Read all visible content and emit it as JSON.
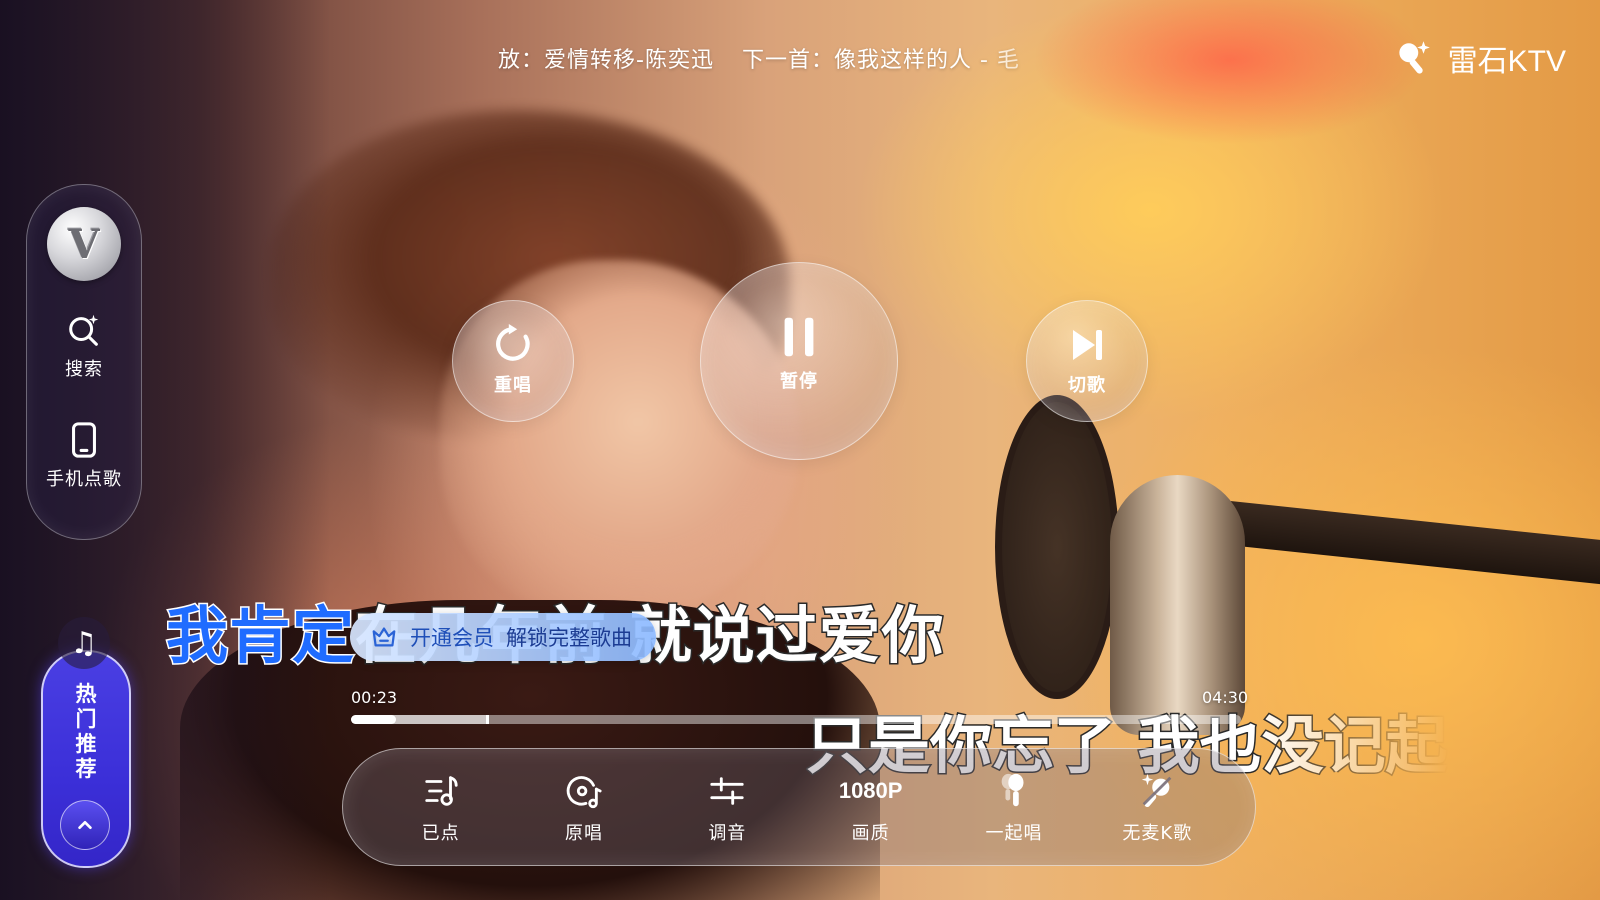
{
  "now_playing": {
    "current": "放：爱情转移-陈奕迅",
    "next": "下一首：像我这样的人 - 毛"
  },
  "brand": {
    "name": "雷石KTV"
  },
  "sidebar": {
    "vip_badge": "V",
    "items": [
      {
        "label": "搜索",
        "icon": "search-sparkle-icon"
      },
      {
        "label": "手机点歌",
        "icon": "phone-icon"
      }
    ],
    "hot": {
      "chars": [
        "热",
        "门",
        "推",
        "荐"
      ],
      "icon": "music-note-icon",
      "toggle_icon": "chevron-up-icon"
    }
  },
  "controls": {
    "restart": {
      "label": "重唱",
      "icon": "restart-icon"
    },
    "pause": {
      "label": "暂停",
      "icon": "pause-icon"
    },
    "skip": {
      "label": "切歌",
      "icon": "skip-next-icon"
    }
  },
  "lyrics": {
    "line1_sung": "我肯定",
    "line1_unsung": "在几年前 就说过爱你",
    "line2": "只是你忘了 我也没记起"
  },
  "vip_promo": {
    "prefix": "开通会员",
    "main": "解锁完整歌曲",
    "icon": "crown-icon"
  },
  "progress": {
    "current_time": "00:23",
    "total_time": "04:30",
    "played_fraction": 0.05,
    "buffered_fraction": 0.152
  },
  "toolbar": {
    "items": [
      {
        "label": "已点",
        "icon": "queue-list-icon"
      },
      {
        "label": "原唱",
        "icon": "original-vocal-icon"
      },
      {
        "label": "调音",
        "icon": "equalizer-icon"
      },
      {
        "label": "画质",
        "icon_text": "1080P"
      },
      {
        "label": "一起唱",
        "icon": "duet-mic-icon"
      },
      {
        "label": "无麦K歌",
        "icon": "no-mic-icon"
      }
    ]
  },
  "colors": {
    "lyric_sung": "#1f6cff",
    "hot_button": "#3b2fd8",
    "vip_text": "#1c3c93"
  }
}
